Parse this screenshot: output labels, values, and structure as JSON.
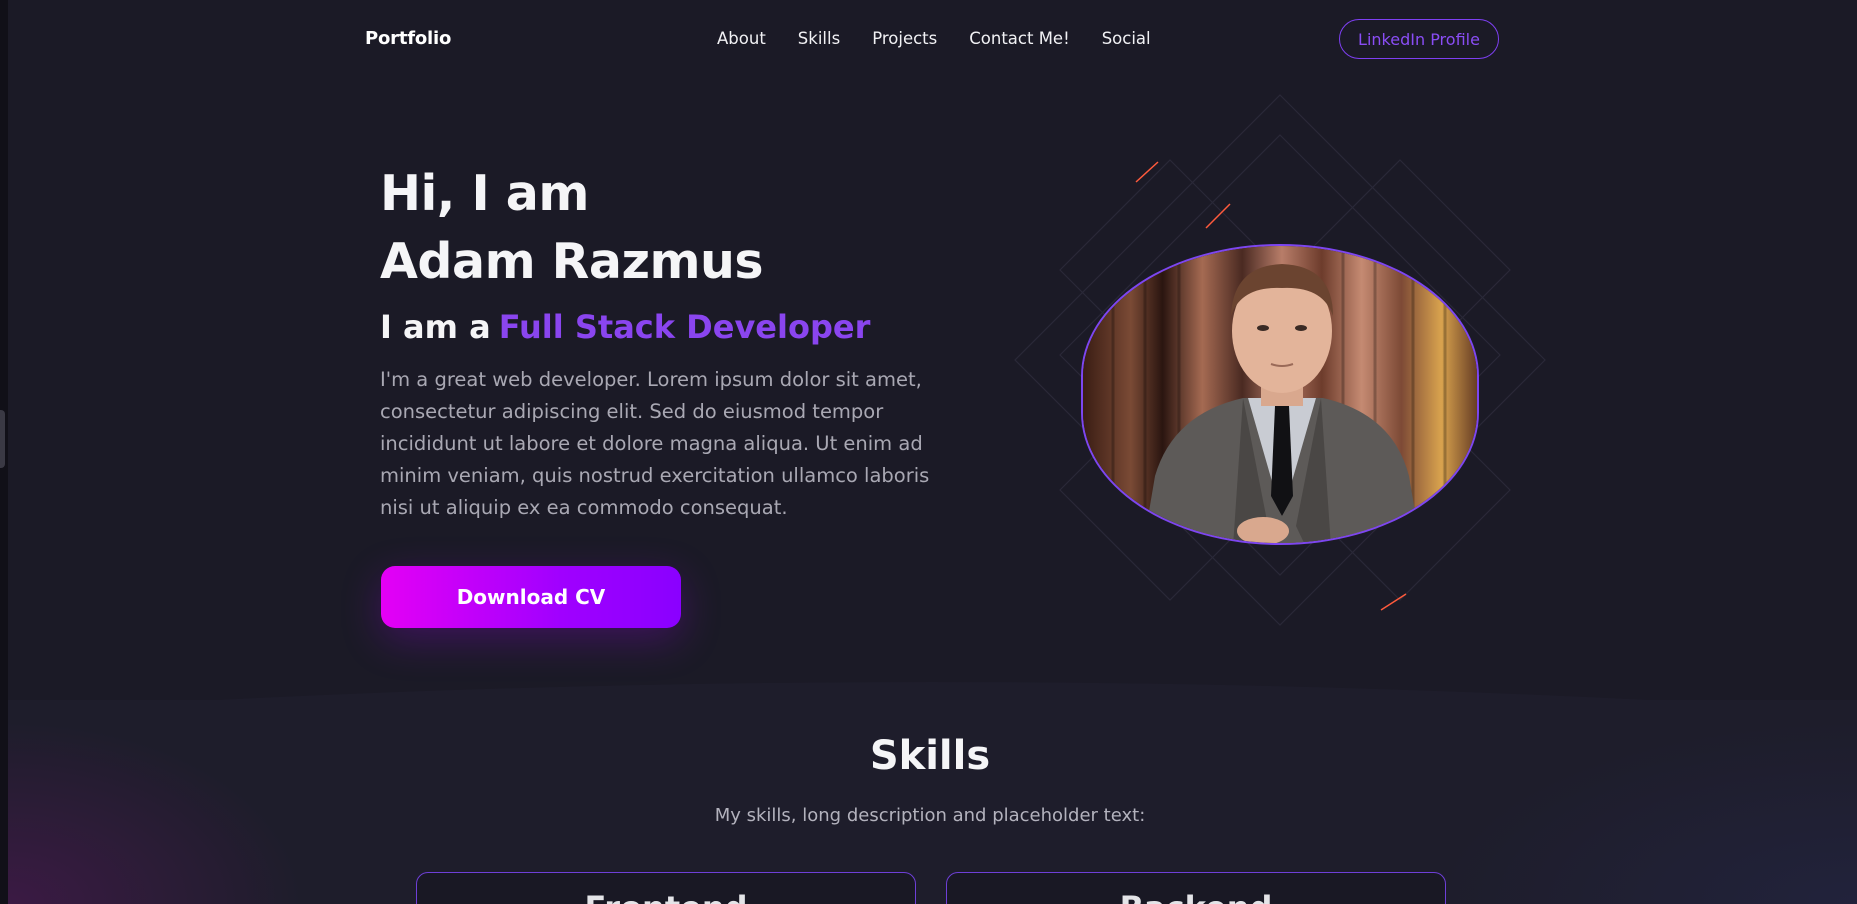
{
  "nav": {
    "brand": "Portfolio",
    "items": [
      "About",
      "Skills",
      "Projects",
      "Contact Me!",
      "Social"
    ],
    "cta": "LinkedIn Profile"
  },
  "hero": {
    "greeting": "Hi, I am",
    "name": "Adam Razmus",
    "role_prefix": "I am a",
    "role": "Full Stack Developer",
    "description": "I'm a great web developer. Lorem ipsum dolor sit amet, consectetur adipiscing elit. Sed do eiusmod tempor incididunt ut labore et dolore magna aliqua. Ut enim ad minim veniam, quis nostrud exercitation ullamco laboris nisi ut aliquip ex ea commodo consequat.",
    "button": "Download CV"
  },
  "skills": {
    "title": "Skills",
    "description": "My skills, long description and placeholder text:",
    "cards": [
      "Frontend",
      "Backend"
    ]
  },
  "colors": {
    "background": "#1b1a26",
    "accent": "#8a45ef",
    "button_gradient_start": "#e400f5",
    "button_gradient_end": "#8a00ff"
  }
}
